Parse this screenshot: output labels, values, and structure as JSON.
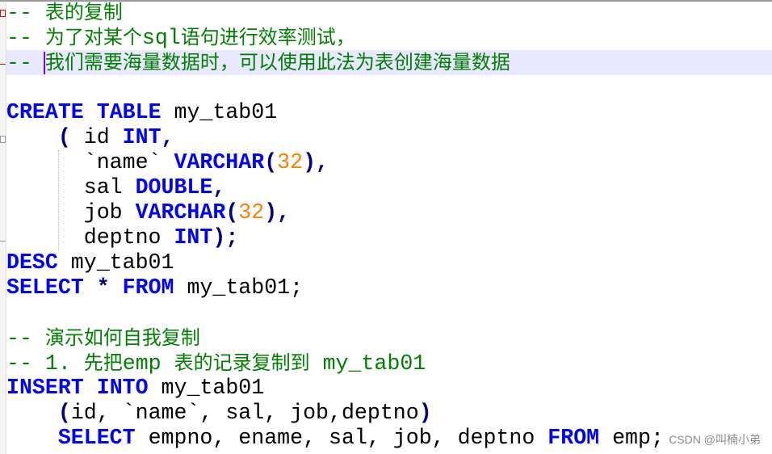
{
  "editor": {
    "current_line": 2,
    "colors": {
      "keyword": "#0000FF",
      "comment": "#008000",
      "number": "#FF8000",
      "operator": "#000080",
      "text": "#000000",
      "current_line_bg": "#E8E8FF"
    },
    "lines": [
      [
        {
          "t": "-- ",
          "c": "cm"
        },
        {
          "t": "表的复制",
          "c": "cm cjk"
        }
      ],
      [
        {
          "t": "-- ",
          "c": "cm"
        },
        {
          "t": "为了对某个",
          "c": "cm cjk"
        },
        {
          "t": "sql",
          "c": "cm"
        },
        {
          "t": "语句进行效率测试，",
          "c": "cm cjk"
        }
      ],
      [
        {
          "t": "-- ",
          "c": "cm"
        },
        {
          "t": "caret",
          "c": "caret"
        },
        {
          "t": "我们需要海量数据时，可以使用此法为表创建海量数据",
          "c": "cm cjk"
        }
      ],
      [],
      [
        {
          "t": "CREATE",
          "c": "kw"
        },
        {
          "t": " ",
          "c": "tx"
        },
        {
          "t": "TABLE",
          "c": "kw"
        },
        {
          "t": " my_tab01",
          "c": "tx"
        }
      ],
      [
        {
          "t": "    ",
          "c": "tx"
        },
        {
          "t": "(",
          "c": "op"
        },
        {
          "t": " id ",
          "c": "tx"
        },
        {
          "t": "INT",
          "c": "kw"
        },
        {
          "t": ",",
          "c": "op"
        }
      ],
      [
        {
          "t": "      `name` ",
          "c": "tx"
        },
        {
          "t": "VARCHAR",
          "c": "kw"
        },
        {
          "t": "(",
          "c": "op"
        },
        {
          "t": "32",
          "c": "num"
        },
        {
          "t": "),",
          "c": "op"
        }
      ],
      [
        {
          "t": "      sal ",
          "c": "tx"
        },
        {
          "t": "DOUBLE",
          "c": "kw"
        },
        {
          "t": ",",
          "c": "op"
        }
      ],
      [
        {
          "t": "      job ",
          "c": "tx"
        },
        {
          "t": "VARCHAR",
          "c": "kw"
        },
        {
          "t": "(",
          "c": "op"
        },
        {
          "t": "32",
          "c": "num"
        },
        {
          "t": "),",
          "c": "op"
        }
      ],
      [
        {
          "t": "      deptno ",
          "c": "tx"
        },
        {
          "t": "INT",
          "c": "kw"
        },
        {
          "t": ");",
          "c": "op"
        }
      ],
      [
        {
          "t": "DESC",
          "c": "kw"
        },
        {
          "t": " my_tab01",
          "c": "tx"
        }
      ],
      [
        {
          "t": "SELECT",
          "c": "kw"
        },
        {
          "t": " ",
          "c": "tx"
        },
        {
          "t": "*",
          "c": "op"
        },
        {
          "t": " ",
          "c": "tx"
        },
        {
          "t": "FROM",
          "c": "kw"
        },
        {
          "t": " my_tab01;",
          "c": "tx"
        }
      ],
      [],
      [
        {
          "t": "-- ",
          "c": "cm"
        },
        {
          "t": "演示如何自我复制",
          "c": "cm cjk"
        }
      ],
      [
        {
          "t": "-- 1. ",
          "c": "cm"
        },
        {
          "t": "先把",
          "c": "cm cjk"
        },
        {
          "t": "emp ",
          "c": "cm"
        },
        {
          "t": "表的记录复制到",
          "c": "cm cjk"
        },
        {
          "t": " my_tab01",
          "c": "cm"
        }
      ],
      [
        {
          "t": "INSERT",
          "c": "kw"
        },
        {
          "t": " ",
          "c": "tx"
        },
        {
          "t": "INTO",
          "c": "kw"
        },
        {
          "t": " my_tab01",
          "c": "tx"
        }
      ],
      [
        {
          "t": "    ",
          "c": "tx"
        },
        {
          "t": "(",
          "c": "op"
        },
        {
          "t": "id, `name`, sal, job,deptno",
          "c": "tx"
        },
        {
          "t": ")",
          "c": "op"
        }
      ],
      [
        {
          "t": "    ",
          "c": "tx"
        },
        {
          "t": "SELECT",
          "c": "kw"
        },
        {
          "t": " empno, ename, sal, job, deptno ",
          "c": "tx"
        },
        {
          "t": "FROM",
          "c": "kw"
        },
        {
          "t": " emp;",
          "c": "tx"
        }
      ]
    ]
  },
  "watermark": "CSDN @叫楠小弟"
}
